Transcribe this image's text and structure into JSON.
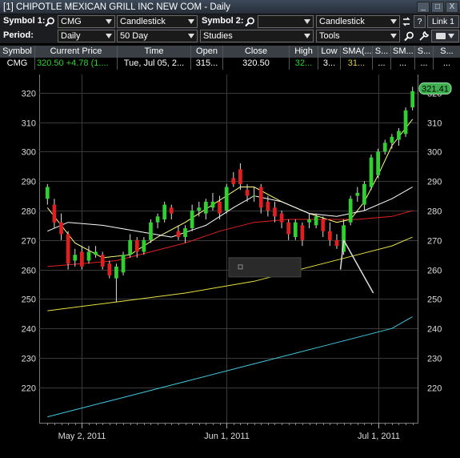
{
  "window": {
    "title": "[1] CHIPOTLE MEXICAN GRILL INC NEW COM - Daily",
    "buttons": [
      "_",
      "□",
      "X"
    ]
  },
  "toolbar1": {
    "symbol1_label": "Symbol 1:",
    "symbol1_value": "CMG",
    "chart_type1": "Candlestick",
    "symbol2_label": "Symbol 2:",
    "symbol2_value": "",
    "chart_type2": "Candlestick",
    "help_label": "?",
    "link_label": "Link 1"
  },
  "toolbar2": {
    "period_label": "Period:",
    "period_value": "Daily",
    "range_value": "50 Day",
    "studies_value": "Studies",
    "tools_value": "Tools"
  },
  "quote_table": {
    "headers": [
      "Symbol",
      "Current Price",
      "Time",
      "Open",
      "Close",
      "High",
      "Low",
      "SMA(...",
      "S...",
      "SM...",
      "S...",
      "S..."
    ],
    "row": {
      "symbol": "CMG",
      "price": "320.50",
      "change": "+4.78 (1....",
      "time": "Tue, Jul 05, 2...",
      "open": "315...",
      "close": "320.50",
      "high": "32...",
      "low": "3...",
      "sma": "31...",
      "s1": "...",
      "sm": "...",
      "s2": "...",
      "s3": "..."
    }
  },
  "colors": {
    "up": "#2fd02f",
    "down": "#e02020",
    "sma_short": "#ffff80",
    "sma_mid": "#ffffff",
    "sma_red": "#e02020",
    "sma_long": "#e8e040",
    "sma_longest": "#40c8e0",
    "last_price_tag": "#3fb04f"
  },
  "chart_data": {
    "type": "candlestick",
    "ylim": [
      208,
      324
    ],
    "yticks": [
      220,
      230,
      240,
      250,
      260,
      270,
      280,
      290,
      300,
      310,
      320
    ],
    "ytick_labels": [
      "220",
      "230",
      "240",
      "250",
      "260",
      "270",
      "280",
      "290",
      "300",
      "310",
      "320"
    ],
    "xlabels": [
      {
        "label": "May 2, 2011",
        "index": 5
      },
      {
        "label": "Jun 1, 2011",
        "index": 26
      },
      {
        "label": "Jul 1, 2011",
        "index": 48
      }
    ],
    "last_price_label": "321.41",
    "candles": [
      {
        "o": 284,
        "h": 289,
        "c": 288,
        "l": 282
      },
      {
        "o": 282,
        "h": 284,
        "c": 276,
        "l": 274
      },
      {
        "o": 276,
        "h": 279,
        "c": 272,
        "l": 270
      },
      {
        "o": 272,
        "h": 273,
        "c": 262,
        "l": 260
      },
      {
        "o": 263,
        "h": 267,
        "c": 265,
        "l": 261
      },
      {
        "o": 266,
        "h": 268,
        "c": 261,
        "l": 260
      },
      {
        "o": 263,
        "h": 268,
        "c": 266,
        "l": 262
      },
      {
        "o": 265,
        "h": 268,
        "c": 266,
        "l": 264
      },
      {
        "o": 265,
        "h": 266,
        "c": 261,
        "l": 260
      },
      {
        "o": 262,
        "h": 263,
        "c": 258,
        "l": 257
      },
      {
        "o": 257,
        "h": 262,
        "c": 261,
        "l": 249
      },
      {
        "o": 259,
        "h": 266,
        "c": 265,
        "l": 258
      },
      {
        "o": 265,
        "h": 272,
        "c": 270,
        "l": 264
      },
      {
        "o": 270,
        "h": 271,
        "c": 266,
        "l": 264
      },
      {
        "o": 266,
        "h": 271,
        "c": 270,
        "l": 265
      },
      {
        "o": 270,
        "h": 277,
        "c": 276,
        "l": 269
      },
      {
        "o": 276,
        "h": 279,
        "c": 278,
        "l": 274
      },
      {
        "o": 277,
        "h": 283,
        "c": 282,
        "l": 276
      },
      {
        "o": 281,
        "h": 282,
        "c": 279,
        "l": 277
      },
      {
        "o": 273,
        "h": 275,
        "c": 271,
        "l": 270
      },
      {
        "o": 271,
        "h": 275,
        "c": 274,
        "l": 269
      },
      {
        "o": 274,
        "h": 282,
        "c": 280,
        "l": 273
      },
      {
        "o": 280,
        "h": 283,
        "c": 281,
        "l": 278
      },
      {
        "o": 279,
        "h": 284,
        "c": 283,
        "l": 277
      },
      {
        "o": 281,
        "h": 286,
        "c": 283,
        "l": 280
      },
      {
        "o": 283,
        "h": 285,
        "c": 279,
        "l": 277
      },
      {
        "o": 280,
        "h": 289,
        "c": 288,
        "l": 279
      },
      {
        "o": 291,
        "h": 293,
        "c": 289,
        "l": 288
      },
      {
        "o": 294,
        "h": 296,
        "c": 289,
        "l": 287
      },
      {
        "o": 287,
        "h": 289,
        "c": 285,
        "l": 283
      },
      {
        "o": 285,
        "h": 288,
        "c": 285,
        "l": 283
      },
      {
        "o": 288,
        "h": 289,
        "c": 281,
        "l": 279
      },
      {
        "o": 283,
        "h": 285,
        "c": 280,
        "l": 278
      },
      {
        "o": 281,
        "h": 283,
        "c": 278,
        "l": 276
      },
      {
        "o": 279,
        "h": 280,
        "c": 276,
        "l": 274
      },
      {
        "o": 276,
        "h": 277,
        "c": 272,
        "l": 270
      },
      {
        "o": 271,
        "h": 277,
        "c": 276,
        "l": 270
      },
      {
        "o": 275,
        "h": 276,
        "c": 270,
        "l": 268
      },
      {
        "o": 276,
        "h": 279,
        "c": 277,
        "l": 274
      },
      {
        "o": 275,
        "h": 279,
        "c": 278,
        "l": 274
      },
      {
        "o": 277,
        "h": 278,
        "c": 273,
        "l": 271
      },
      {
        "o": 273,
        "h": 276,
        "c": 270,
        "l": 268
      },
      {
        "o": 270,
        "h": 272,
        "c": 268,
        "l": 267
      },
      {
        "o": 266,
        "h": 277,
        "c": 275,
        "l": 265
      },
      {
        "o": 276,
        "h": 285,
        "c": 284,
        "l": 275
      },
      {
        "o": 285,
        "h": 288,
        "c": 286,
        "l": 283
      },
      {
        "o": 282,
        "h": 290,
        "c": 289,
        "l": 280
      },
      {
        "o": 288,
        "h": 299,
        "c": 298,
        "l": 287
      },
      {
        "o": 292,
        "h": 301,
        "c": 300,
        "l": 291
      },
      {
        "o": 300,
        "h": 304,
        "c": 303,
        "l": 299
      },
      {
        "o": 303,
        "h": 306,
        "c": 305,
        "l": 301
      },
      {
        "o": 304,
        "h": 308,
        "c": 307,
        "l": 302
      },
      {
        "o": 306,
        "h": 315,
        "c": 314,
        "l": 305
      },
      {
        "o": 315,
        "h": 322,
        "c": 320.5,
        "l": 314
      }
    ],
    "series": [
      {
        "key": "sma_short",
        "x": [
          0,
          4,
          8,
          12,
          16,
          20,
          24,
          28,
          30,
          34,
          38,
          42,
          44,
          46,
          48,
          50,
          53
        ],
        "values": [
          281,
          269,
          264,
          265,
          271,
          276,
          282,
          288,
          288,
          283,
          279,
          276,
          277,
          283,
          292,
          302,
          311
        ]
      },
      {
        "key": "sma_mid",
        "x": [
          0,
          3,
          8,
          13,
          18,
          23,
          27,
          30,
          34,
          38,
          42,
          46,
          50,
          53
        ],
        "values": [
          273,
          276,
          275,
          273,
          271,
          275,
          281,
          285,
          283,
          279,
          278,
          280,
          284,
          288
        ]
      },
      {
        "key": "sma_red",
        "x": [
          0,
          5,
          10,
          15,
          20,
          25,
          30,
          35,
          40,
          45,
          50,
          53
        ],
        "values": [
          261,
          262,
          263,
          266,
          269,
          273,
          276,
          277,
          277,
          277,
          278,
          280
        ]
      },
      {
        "key": "sma_long",
        "x": [
          0,
          10,
          20,
          30,
          40,
          45,
          50,
          53
        ],
        "values": [
          246,
          249,
          252,
          256,
          262,
          265,
          268,
          271
        ]
      },
      {
        "key": "sma_longest",
        "x": [
          0,
          10,
          20,
          30,
          40,
          50,
          53
        ],
        "values": [
          210,
          216,
          222,
          228,
          234,
          240,
          244
        ]
      }
    ]
  }
}
